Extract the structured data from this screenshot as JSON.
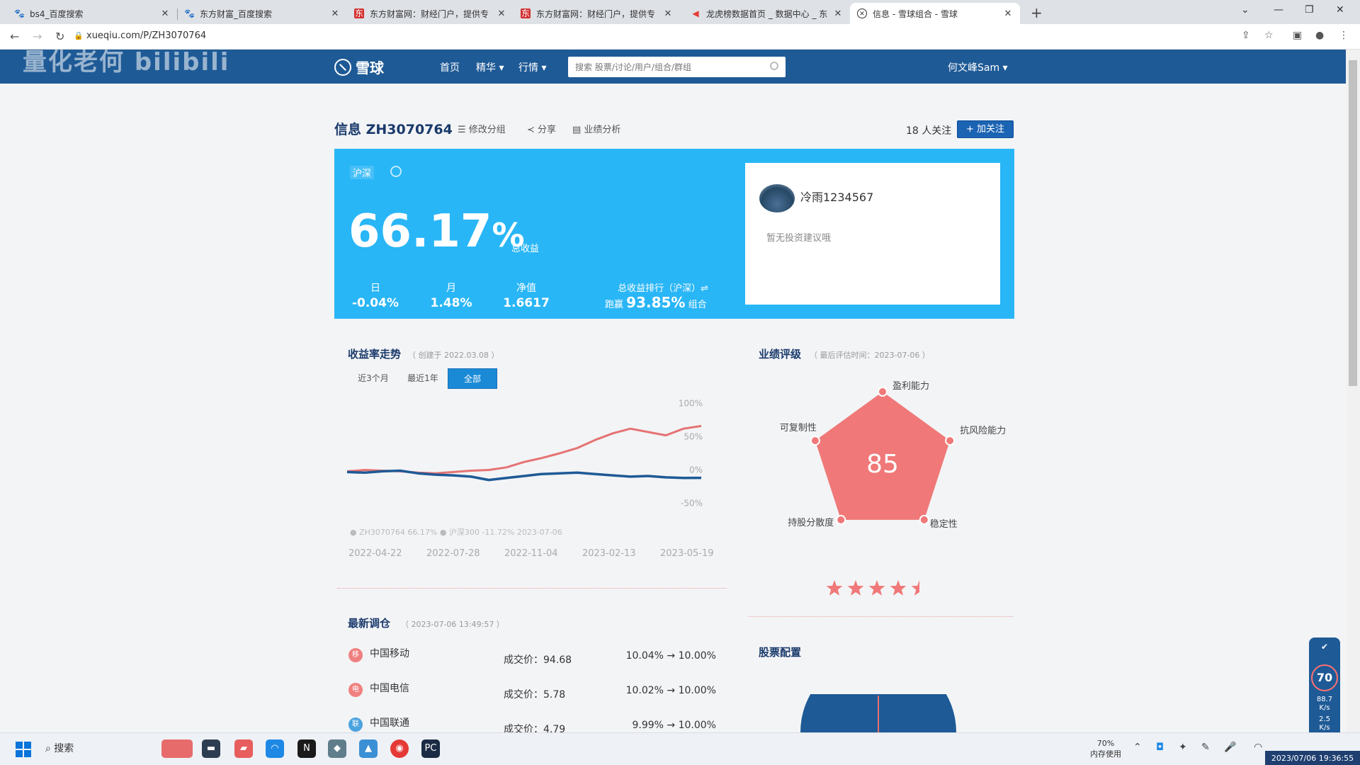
{
  "browser": {
    "tabs": [
      {
        "title": "bs4_百度搜索",
        "icon": "baidu-paw-icon"
      },
      {
        "title": "东方财富_百度搜索",
        "icon": "baidu-paw-icon"
      },
      {
        "title": "东方财富网：财经门户，提供专",
        "icon": "eastmoney-icon"
      },
      {
        "title": "东方财富网：财经门户，提供专",
        "icon": "eastmoney-icon"
      },
      {
        "title": "龙虎榜数据首页 _ 数据中心 _ 东",
        "icon": "megaphone-icon"
      },
      {
        "title": "信息 - 雪球组合 - 雪球",
        "icon": "xueqiu-icon"
      }
    ],
    "url": "xueqiu.com/P/ZH3070764"
  },
  "site": {
    "watermark": "量化老何 bilibili",
    "logo": "雪球",
    "nav": [
      "首页",
      "精华",
      "行情"
    ],
    "search_placeholder": "搜索 股票/讨论/用户/组合/群组",
    "user": "何文峰Sam"
  },
  "portfolio": {
    "title": "信息 ZH3070764",
    "actions": [
      "修改分组",
      "分享",
      "业绩分析"
    ],
    "followers": "18 人关注",
    "follow_btn": "+ 加关注",
    "market_badge": "沪深",
    "total_return": "66.17",
    "total_return_pct": "%",
    "total_return_label": "总收益",
    "stats": [
      {
        "label": "日",
        "value": "-0.04%"
      },
      {
        "label": "月",
        "value": "1.48%"
      },
      {
        "label": "净值",
        "value": "1.6617"
      }
    ],
    "rank_label": "总收益排行（沪深）⇌",
    "rank_prefix": "跑赢",
    "rank_value": "93.85%",
    "rank_suffix": "组合",
    "advisor_name": "冷雨1234567",
    "advisor_note": "暂无投资建议哦"
  },
  "returns": {
    "title": "收益率走势",
    "subtitle": "（ 创建于 2022.03.08 ）",
    "ranges": [
      "近3个月",
      "最近1年",
      "全部"
    ],
    "active_range": "全部",
    "legend_text": "● ZH3070764 66.17%  ● 沪深300 -11.72% 2023-07-06"
  },
  "chart_data": {
    "type": "line",
    "x_ticks": [
      "2022-04-22",
      "2022-07-28",
      "2022-11-04",
      "2023-02-13",
      "2023-05-19"
    ],
    "y_ticks": [
      "100%",
      "50%",
      "0%",
      "-50%"
    ],
    "ylim": [
      -60,
      110
    ],
    "series": [
      {
        "name": "ZH3070764",
        "color": "#e57373",
        "x": [
          0,
          5,
          10,
          15,
          20,
          25,
          30,
          35,
          40,
          45,
          50,
          55,
          60,
          65,
          70,
          75,
          80,
          85,
          90,
          95,
          100
        ],
        "values": [
          -2,
          0,
          -1,
          -2,
          -4,
          -5,
          -3,
          -1,
          0,
          4,
          12,
          18,
          25,
          33,
          45,
          55,
          62,
          57,
          52,
          62,
          66
        ]
      },
      {
        "name": "沪深300",
        "color": "#1e5a96",
        "x": [
          0,
          5,
          10,
          15,
          20,
          25,
          30,
          35,
          40,
          45,
          50,
          55,
          60,
          65,
          70,
          75,
          80,
          85,
          90,
          95,
          100
        ],
        "values": [
          -3,
          -4,
          -2,
          -1,
          -5,
          -7,
          -8,
          -10,
          -15,
          -12,
          -9,
          -6,
          -5,
          -4,
          -6,
          -8,
          -10,
          -9,
          -11,
          -12,
          -11.72
        ]
      }
    ]
  },
  "rating": {
    "title": "业绩评级",
    "subtitle": "（ 最后评估时间：2023-07-06 ）",
    "score": "85",
    "axes": [
      "盈利能力",
      "抗风险能力",
      "稳定性",
      "持股分散度",
      "可复制性"
    ],
    "stars": 4.5,
    "color": "#f07878"
  },
  "rebalance": {
    "title": "最新调仓",
    "subtitle": "（ 2023-07-06 13:49:57 ）",
    "price_prefix": "成交价：",
    "rows": [
      {
        "icon_text": "移",
        "name": "中国移动",
        "price": "94.68",
        "weight": "10.04% → 10.00%"
      },
      {
        "icon_text": "电",
        "name": "中国电信",
        "price": "5.78",
        "weight": "10.02% → 10.00%"
      },
      {
        "icon_text": "联",
        "name": "中国联通",
        "price": "4.79",
        "weight": "9.99% → 10.00%"
      }
    ]
  },
  "allocation": {
    "title": "股票配置"
  },
  "widget": {
    "value": "70",
    "line1": "88.7",
    "line2": "K/s",
    "line3": "2.5",
    "line4": "K/s"
  },
  "taskbar": {
    "search": "搜索",
    "mem_pct": "70%",
    "mem_label": "内存使用",
    "clock": "2023/07/06 19:36:55"
  }
}
